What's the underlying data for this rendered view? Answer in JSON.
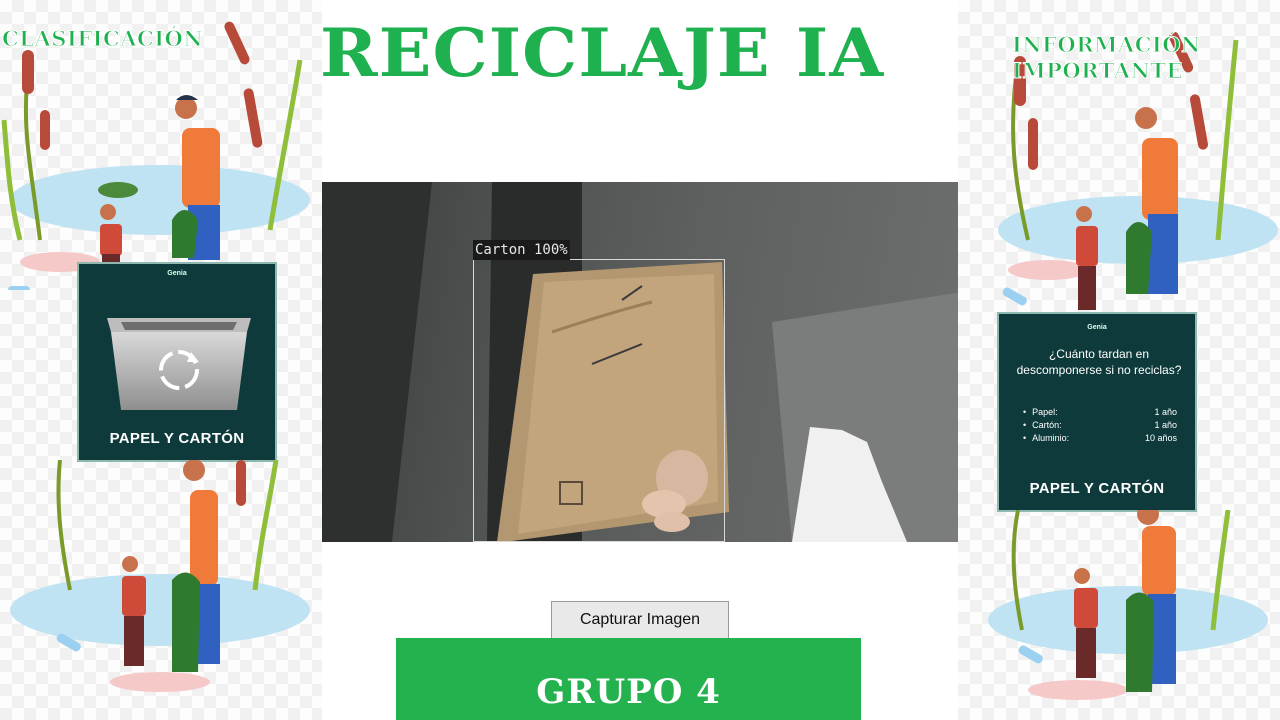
{
  "header": {
    "title": "RECICLAJE IA"
  },
  "left_panel": {
    "heading": "CLASIFICACIÓN",
    "card": {
      "brand": "Genia",
      "icon": "recycle-bin-icon",
      "label": "PAPEL Y CARTÓN"
    }
  },
  "right_panel": {
    "heading_line1": "INFORMACIÓN",
    "heading_line2": "IMPORTANTE",
    "card": {
      "brand": "Genia",
      "question": "¿Cuánto tardan en descomponerse si no reciclas?",
      "items": [
        {
          "name": "Papel:",
          "time": "1 año"
        },
        {
          "name": "Cartón:",
          "time": "1 año"
        },
        {
          "name": "Aluminio:",
          "time": "10 años"
        }
      ],
      "label": "PAPEL Y CARTÓN"
    }
  },
  "camera": {
    "detection_label": "Carton 100%"
  },
  "controls": {
    "capture_label": "Capturar Imagen"
  },
  "footer": {
    "group": "GRUPO 4"
  },
  "colors": {
    "accent_green": "#1fb14f",
    "card_bg": "#0e3a3b",
    "banner_green": "#23b24e"
  }
}
